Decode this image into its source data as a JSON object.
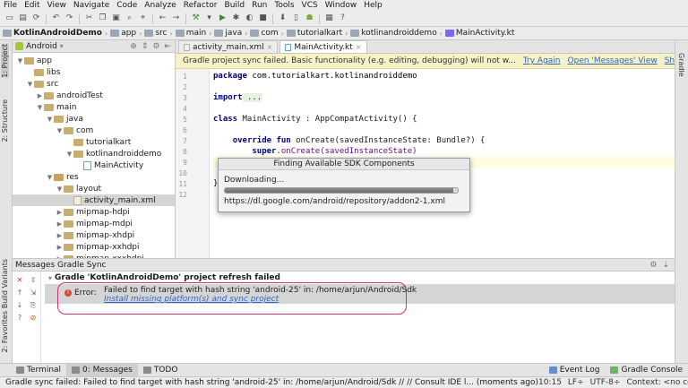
{
  "menu": [
    "File",
    "Edit",
    "View",
    "Navigate",
    "Code",
    "Analyze",
    "Refactor",
    "Build",
    "Run",
    "Tools",
    "VCS",
    "Window",
    "Help"
  ],
  "breadcrumbs": [
    "KotlinAndroidDemo",
    "app",
    "src",
    "main",
    "java",
    "com",
    "tutorialkart",
    "kotlinandroiddemo",
    "MainActivity.kt"
  ],
  "project": {
    "view_label": "Android",
    "tree": [
      {
        "label": "app",
        "depth": 1,
        "open": true,
        "type": "folder"
      },
      {
        "label": "libs",
        "depth": 2,
        "open": null,
        "type": "folder"
      },
      {
        "label": "src",
        "depth": 2,
        "open": true,
        "type": "folder"
      },
      {
        "label": "androidTest",
        "depth": 3,
        "open": false,
        "type": "folder"
      },
      {
        "label": "main",
        "depth": 3,
        "open": true,
        "type": "folder"
      },
      {
        "label": "java",
        "depth": 4,
        "open": true,
        "type": "folder"
      },
      {
        "label": "com",
        "depth": 5,
        "open": true,
        "type": "folder"
      },
      {
        "label": "tutorialkart",
        "depth": 6,
        "open": null,
        "type": "folder"
      },
      {
        "label": "kotlinandroiddemo",
        "depth": 6,
        "open": true,
        "type": "folder"
      },
      {
        "label": "MainActivity",
        "depth": 7,
        "open": null,
        "type": "kt"
      },
      {
        "label": "res",
        "depth": 4,
        "open": true,
        "type": "res"
      },
      {
        "label": "layout",
        "depth": 5,
        "open": true,
        "type": "folder"
      },
      {
        "label": "activity_main.xml",
        "depth": 6,
        "open": null,
        "type": "file",
        "selected": true
      },
      {
        "label": "mipmap-hdpi",
        "depth": 5,
        "open": false,
        "type": "folder"
      },
      {
        "label": "mipmap-mdpi",
        "depth": 5,
        "open": false,
        "type": "folder"
      },
      {
        "label": "mipmap-xhdpi",
        "depth": 5,
        "open": false,
        "type": "folder"
      },
      {
        "label": "mipmap-xxhdpi",
        "depth": 5,
        "open": false,
        "type": "folder"
      },
      {
        "label": "mipmap-xxxhdpi",
        "depth": 5,
        "open": false,
        "type": "folder"
      }
    ]
  },
  "editor": {
    "tabs": [
      {
        "label": "activity_main.xml",
        "active": false
      },
      {
        "label": "MainActivity.kt",
        "active": true
      }
    ],
    "banner": {
      "message": "Gradle project sync failed. Basic functionality (e.g. editing, debugging) will not w...",
      "links": [
        "Try Again",
        "Open 'Messages' View",
        "Show Log in Files"
      ]
    },
    "line_numbers": [
      "1",
      "2",
      "3",
      "4",
      "5",
      "6",
      "7",
      "8",
      "9",
      "10",
      "11",
      "12"
    ],
    "code": {
      "l1_kw": "package",
      "l1_rest": " com.tutorialkart.kotlinandroiddemo",
      "l3_kw": "import",
      "l3_rest": " ...",
      "l5_kw": "class",
      "l5_rest": " MainActivity : AppCompatActivity() {",
      "l7_kw": "override fun",
      "l7_rest": " onCreate(savedInstanceState: Bundle?) {",
      "l8_kw": "super",
      "l8_rest": ".onCreate(savedInstanceState)",
      "l11_rest": "}"
    }
  },
  "dialog": {
    "title": "Finding Available SDK Components",
    "status": "Downloading...",
    "progress": 0.98,
    "url": "https://dl.google.com/android/repository/addon2-1.xml"
  },
  "messages": {
    "header": "Messages Gradle Sync",
    "title": "Gradle 'KotlinAndroidDemo' project refresh failed",
    "error_label": "Error:",
    "error_text": "Failed to find target with hash string 'android-25' in: /home/arjun/Android/Sdk",
    "error_link": "Install missing platform(s) and sync project"
  },
  "side_tabs": {
    "left": [
      "1: Project",
      "2: Structure",
      "Build Variants",
      "2: Favorites"
    ],
    "right": [
      "Gradle"
    ]
  },
  "bottom_tabs": {
    "left": [
      "Terminal",
      "0: Messages",
      "TODO"
    ],
    "right": [
      "Event Log",
      "Gradle Console"
    ]
  },
  "status": {
    "message": "Gradle sync failed: Failed to find target with hash string 'android-25' in: /home/arjun/Android/Sdk // // Consult IDE l... (moments ago)",
    "position": "10:15",
    "line_sep": "LF÷",
    "encoding": "UTF-8÷",
    "context": "Context: <no context>"
  }
}
